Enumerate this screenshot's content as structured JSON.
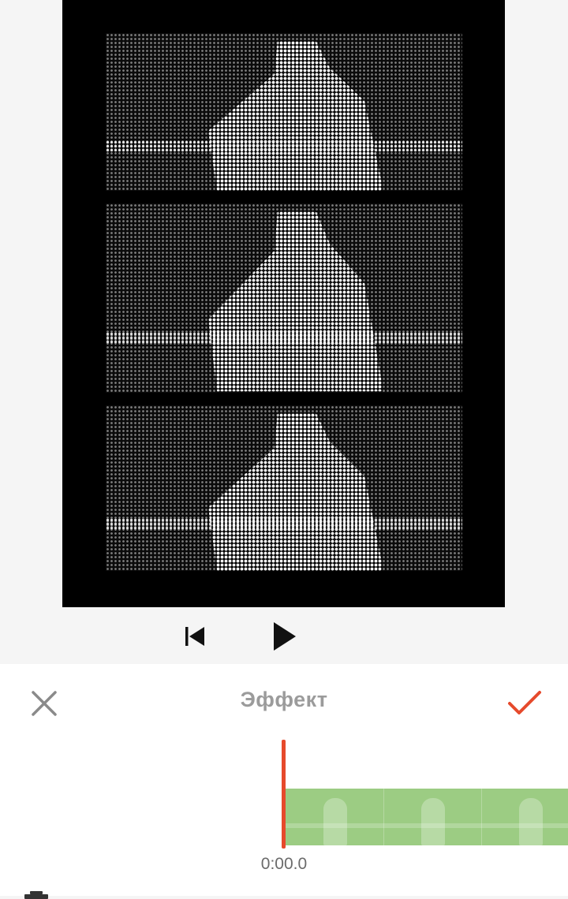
{
  "preview": {
    "strips": 3
  },
  "player": {
    "prev_icon": "skip-to-start-icon",
    "play_icon": "play-icon"
  },
  "panel": {
    "title": "Эффект",
    "close_icon": "close-icon",
    "confirm_icon": "checkmark-icon",
    "confirm_color": "#e64a2c",
    "track_color": "#9ccc83",
    "playhead_color": "#e64a2c",
    "time": "0:00.0"
  }
}
